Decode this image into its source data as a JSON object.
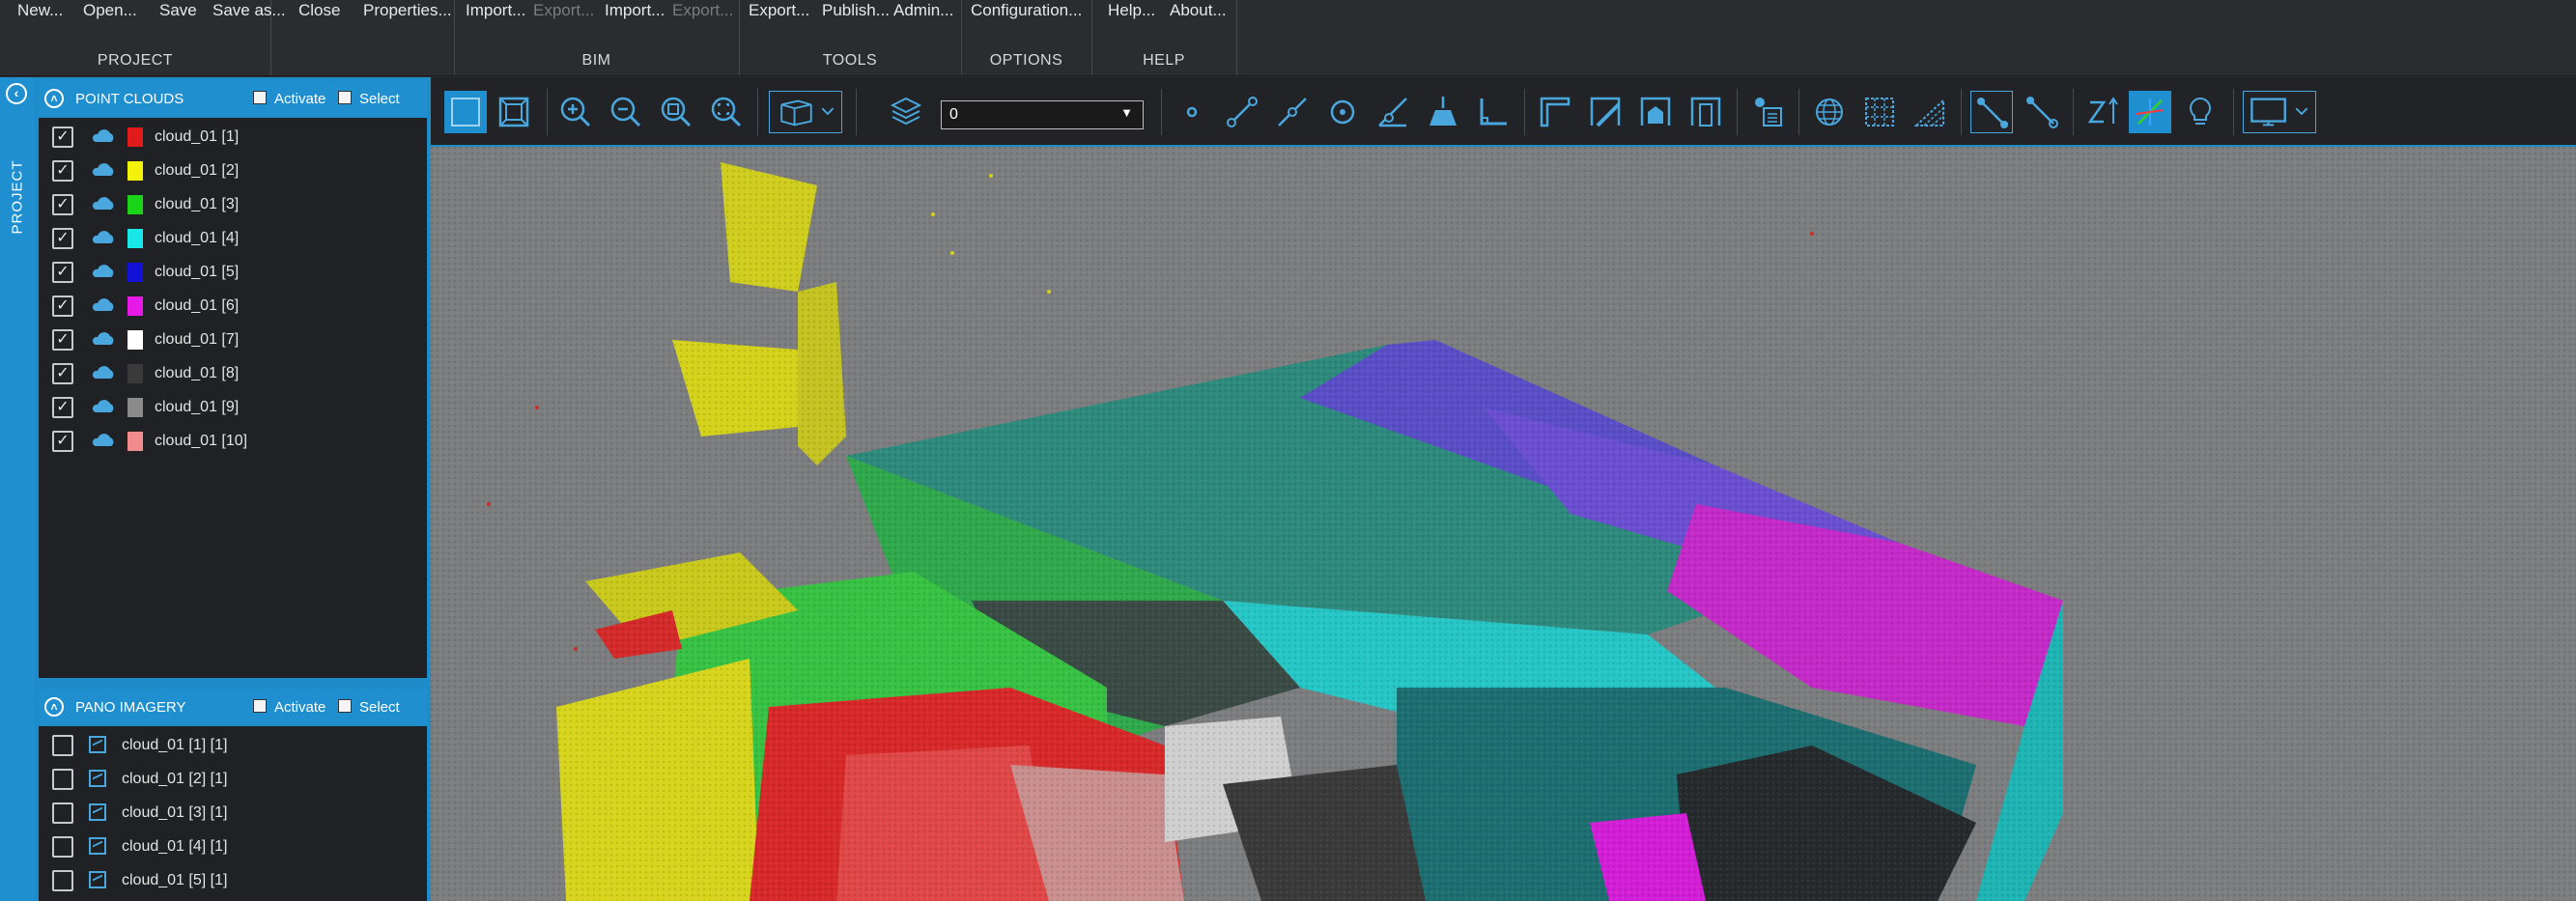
{
  "ribbon": {
    "groups": [
      {
        "id": "project",
        "label": "PROJECT",
        "buttons": [
          {
            "label": "New...",
            "enabled": true
          },
          {
            "label": "Open...",
            "enabled": true
          },
          {
            "label": "Save",
            "enabled": true
          },
          {
            "label": "Save as...",
            "enabled": true
          },
          {
            "label": "Close",
            "enabled": true
          },
          {
            "label": "Properties...",
            "enabled": true
          }
        ]
      },
      {
        "id": "bim",
        "label": "BIM",
        "buttons": [
          {
            "label": "Import...",
            "enabled": true
          },
          {
            "label": "Export...",
            "enabled": false
          },
          {
            "label": "Import...",
            "enabled": true
          },
          {
            "label": "Export...",
            "enabled": false
          }
        ]
      },
      {
        "id": "tools",
        "label": "TOOLS",
        "buttons": [
          {
            "label": "Export...",
            "enabled": true
          },
          {
            "label": "Publish...",
            "enabled": true
          },
          {
            "label": "Admin...",
            "enabled": true
          }
        ]
      },
      {
        "id": "options",
        "label": "OPTIONS",
        "buttons": [
          {
            "label": "Configuration...",
            "enabled": true
          }
        ]
      },
      {
        "id": "help",
        "label": "HELP",
        "buttons": [
          {
            "label": "Help...",
            "enabled": true
          },
          {
            "label": "About...",
            "enabled": true
          }
        ]
      }
    ]
  },
  "sidebar": {
    "project_label": "PROJECT",
    "point_clouds": {
      "title": "POINT CLOUDS",
      "activate_label": "Activate",
      "select_label": "Select",
      "items": [
        {
          "name": "cloud_01 [1]",
          "checked": true,
          "color": "#e11a1a"
        },
        {
          "name": "cloud_01 [2]",
          "checked": true,
          "color": "#f2f20a"
        },
        {
          "name": "cloud_01 [3]",
          "checked": true,
          "color": "#19d419"
        },
        {
          "name": "cloud_01 [4]",
          "checked": true,
          "color": "#19e6e6"
        },
        {
          "name": "cloud_01 [5]",
          "checked": true,
          "color": "#1212d6"
        },
        {
          "name": "cloud_01 [6]",
          "checked": true,
          "color": "#e619e6"
        },
        {
          "name": "cloud_01 [7]",
          "checked": true,
          "color": "#ffffff"
        },
        {
          "name": "cloud_01 [8]",
          "checked": true,
          "color": "#3a3a3a"
        },
        {
          "name": "cloud_01 [9]",
          "checked": true,
          "color": "#8a8a8a"
        },
        {
          "name": "cloud_01 [10]",
          "checked": true,
          "color": "#f08c8c"
        }
      ]
    },
    "pano_imagery": {
      "title": "PANO IMAGERY",
      "activate_label": "Activate",
      "select_label": "Select",
      "items": [
        {
          "name": "cloud_01 [1] [1]",
          "checked": false
        },
        {
          "name": "cloud_01 [2] [1]",
          "checked": false
        },
        {
          "name": "cloud_01 [3] [1]",
          "checked": false
        },
        {
          "name": "cloud_01 [4] [1]",
          "checked": false
        },
        {
          "name": "cloud_01 [5] [1]",
          "checked": false
        }
      ]
    }
  },
  "toolbar": {
    "layer_value": "0",
    "tools": [
      "select-tool-icon",
      "fit-frame-icon",
      "zoom-in-icon",
      "zoom-out-icon",
      "zoom-window-icon",
      "zoom-extents-icon",
      "view-cube-icon",
      "layers-icon",
      "point-icon",
      "line-icon",
      "polyline-icon",
      "circle-icon",
      "angle-icon",
      "elevation-icon",
      "corner-icon",
      "wall-icon",
      "wall-corner-icon",
      "house-icon",
      "pillar-icon",
      "model-tree-icon",
      "sphere-mesh-icon",
      "grid-icon",
      "terrain-icon",
      "snap-line-icon",
      "snap-segment-icon",
      "z-axis-icon",
      "axes-icon",
      "lightbulb-icon",
      "display-icon"
    ],
    "active_tools": [
      "select-tool-icon",
      "axes-icon"
    ]
  },
  "theme": {
    "accent": "#1f8fd0",
    "viewport_bg": "#7c7d7f"
  }
}
